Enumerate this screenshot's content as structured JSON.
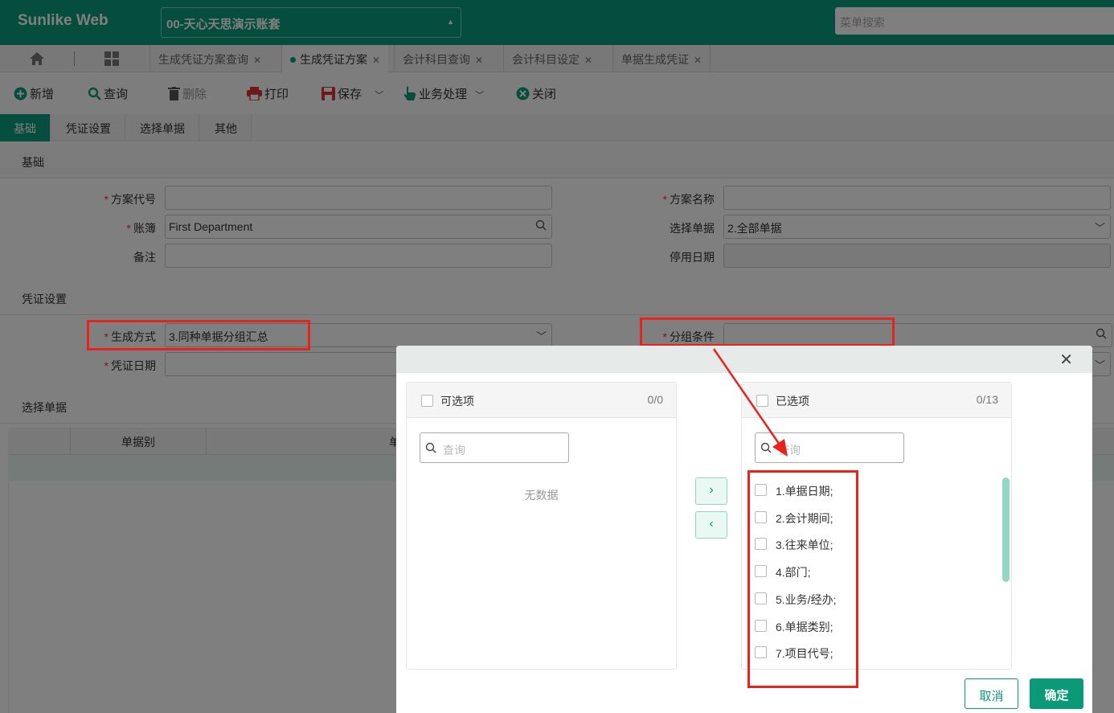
{
  "header": {
    "brand": "Sunlike Web",
    "account": "00-天心天思演示账套",
    "menu_search_placeholder": "菜单搜索"
  },
  "tabs": [
    {
      "label": "生成凭证方案查询",
      "active": false
    },
    {
      "label": "生成凭证方案",
      "active": true
    },
    {
      "label": "会计科目查询",
      "active": false
    },
    {
      "label": "会计科目设定",
      "active": false
    },
    {
      "label": "单据生成凭证",
      "active": false
    }
  ],
  "toolbar": {
    "new": "新增",
    "query": "查询",
    "delete": "删除",
    "print": "打印",
    "save": "保存",
    "business": "业务处理",
    "close": "关闭"
  },
  "subtabs": [
    "基础",
    "凭证设置",
    "选择单据",
    "其他"
  ],
  "basic": {
    "title": "基础",
    "scheme_code_label": "方案代号",
    "scheme_code": "",
    "scheme_name_label": "方案名称",
    "scheme_name": "",
    "ledger_label": "账簿",
    "ledger": "First Department",
    "select_bill_label": "选择单据",
    "select_bill": "2.全部单据",
    "remark_label": "备注",
    "remark": "",
    "disable_date_label": "停用日期",
    "disable_date": ""
  },
  "voucher": {
    "title": "凭证设置",
    "gen_mode_label": "生成方式",
    "gen_mode": "3.同种单据分组汇总",
    "group_cond_label": "分组条件",
    "group_cond": "",
    "voucher_date_label": "凭证日期",
    "voucher_date": ""
  },
  "bills": {
    "title": "选择单据",
    "col1": "单据别",
    "col2": "单"
  },
  "dialog": {
    "left_title": "可选项",
    "left_count": "0/0",
    "left_search_placeholder": "查询",
    "no_data": "无数据",
    "right_title": "已选项",
    "right_count": "0/13",
    "right_search_placeholder": "查询",
    "items": [
      "1.单据日期;",
      "2.会计期间;",
      "3.往来单位;",
      "4.部门;",
      "5.业务/经办;",
      "6.单据类别;",
      "7.项目代号;"
    ],
    "cancel": "取消",
    "ok": "确定"
  },
  "colors": {
    "primary": "#0a9a78",
    "annotation": "#e8231c"
  }
}
